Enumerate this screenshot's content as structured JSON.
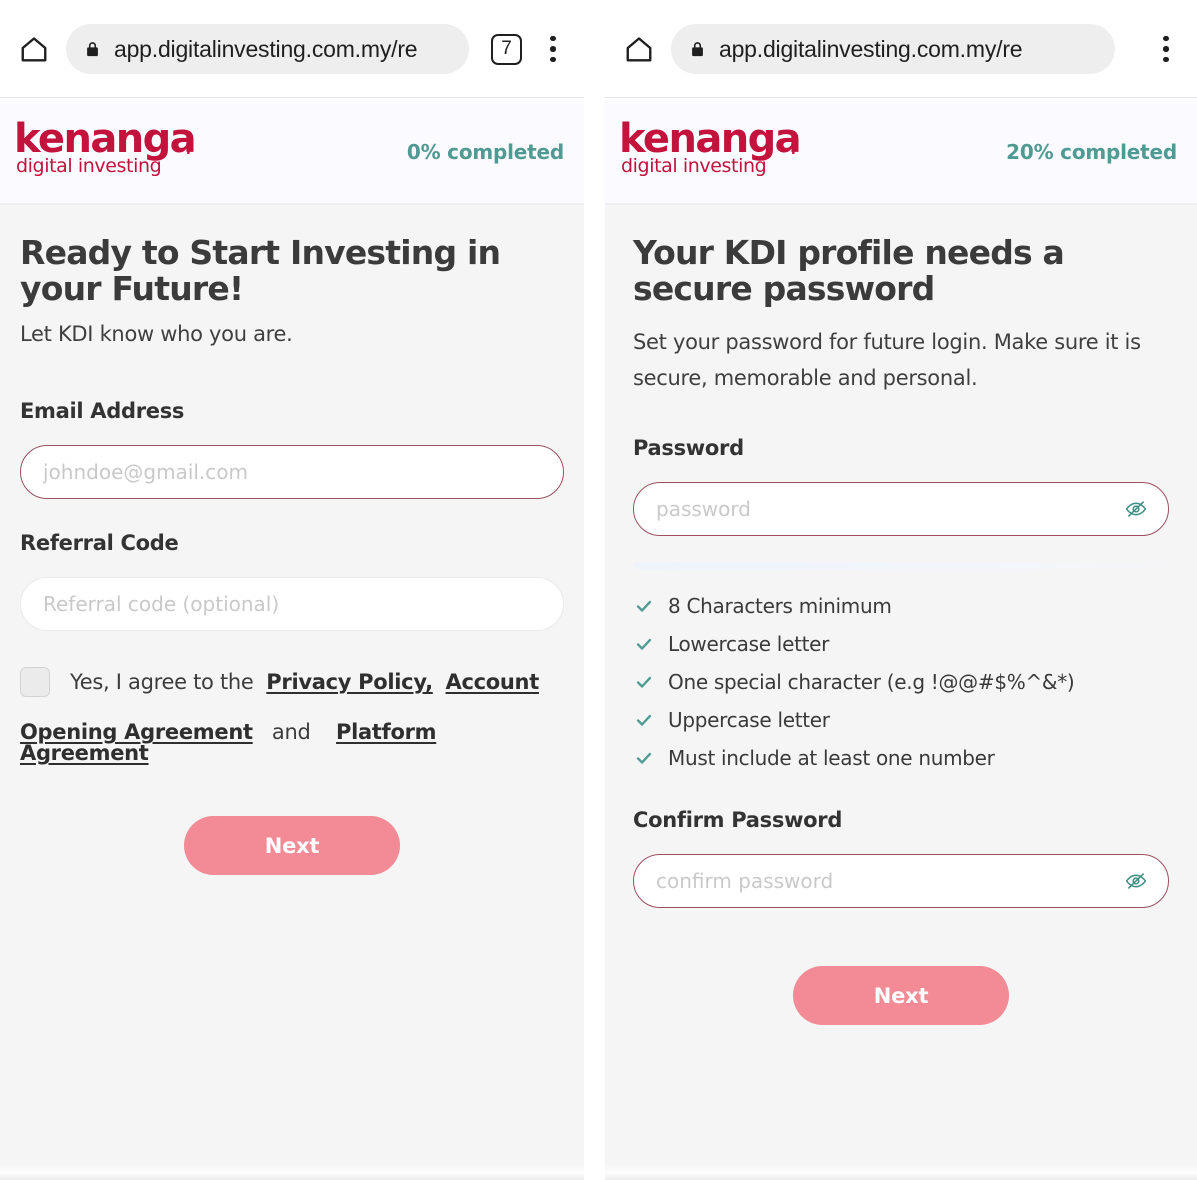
{
  "browser": {
    "url": "app.digitalinvesting.com.my/re",
    "tab_count": "7",
    "home_icon": "home-icon",
    "lock_icon": "lock-icon",
    "menu_icon": "kebab-menu-icon"
  },
  "brand": {
    "name": "kenanga",
    "tagline": "digital investing",
    "dot": ".",
    "color": "#c3123c"
  },
  "colors": {
    "accent_pink": "#f28b95",
    "progress_teal": "#4f9a92",
    "input_border": "#9d5060",
    "page_bg": "#f5f5f5",
    "header_bg": "#fafaff"
  },
  "screen_left": {
    "progress": "0% completed",
    "title": "Ready to Start Investing in your Future!",
    "subtitle": "Let KDI know who you are.",
    "email": {
      "label": "Email Address",
      "placeholder": "johndoe@gmail.com",
      "value": ""
    },
    "referral": {
      "label": "Referral Code",
      "placeholder": "Referral code (optional)",
      "value": ""
    },
    "agreement": {
      "checked": false,
      "intro": "Yes, I agree to the",
      "link_privacy": "Privacy Policy,",
      "link_account_opening": "Account Opening Agreement",
      "conjunction": "and",
      "link_platform": "Platform Agreement"
    },
    "next_label": "Next"
  },
  "screen_right": {
    "progress": "20% completed",
    "title": "Your KDI profile needs a secure password",
    "subtitle": "Set your password for future login. Make sure it is secure, memorable and personal.",
    "password": {
      "label": "Password",
      "placeholder": "password",
      "value": "",
      "toggle_icon": "eye-off-icon"
    },
    "confirm_password": {
      "label": "Confirm Password",
      "placeholder": "confirm password",
      "value": "",
      "toggle_icon": "eye-off-icon"
    },
    "requirements": [
      "8 Characters minimum",
      "Lowercase letter",
      "One special character (e.g !@@#$%^&*)",
      "Uppercase letter",
      "Must include at least one number"
    ],
    "next_label": "Next"
  }
}
